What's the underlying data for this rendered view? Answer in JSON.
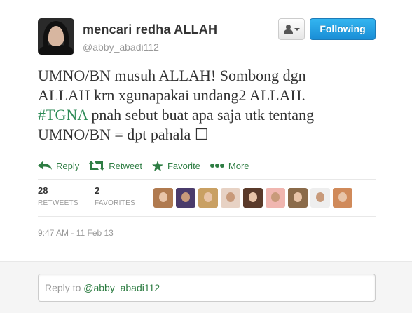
{
  "user": {
    "full_name": "mencari redha ALLAH",
    "username": "@abby_abadi112",
    "avatar_icon": "user-avatar-photo"
  },
  "header_actions": {
    "user_menu_icon": "person-dropdown-icon",
    "follow_label": "Following"
  },
  "tweet": {
    "text_line1": "UMNO/BN musuh ALLAH! Sombong dgn",
    "text_line2": "ALLAH krn xgunapakai undang2 ALLAH.",
    "hashtag": "#TGNA",
    "text_line3_rest": " pnah sebut buat apa saja utk tentang",
    "text_line4": "UMNO/BN = dpt pahala ☐"
  },
  "actions": {
    "reply": "Reply",
    "retweet": "Retweet",
    "favorite": "Favorite",
    "more": "More"
  },
  "stats": {
    "retweets_count": "28",
    "retweets_label": "RETWEETS",
    "favorites_count": "2",
    "favorites_label": "FAVORITES",
    "avatar_colors": [
      "#b07a4f",
      "#4a3b6b",
      "#c9a063",
      "#e7d2c4",
      "#5a3a2a",
      "#f0b6b0",
      "#8b6b4a",
      "#eeeeee",
      "#d08a5a"
    ]
  },
  "timestamp": "9:47 AM - 11 Feb 13",
  "reply": {
    "prefix": "Reply to ",
    "mention": "@abby_abadi112"
  },
  "colors": {
    "accent_green": "#2e7d43",
    "follow_blue": "#1a8ed6"
  }
}
